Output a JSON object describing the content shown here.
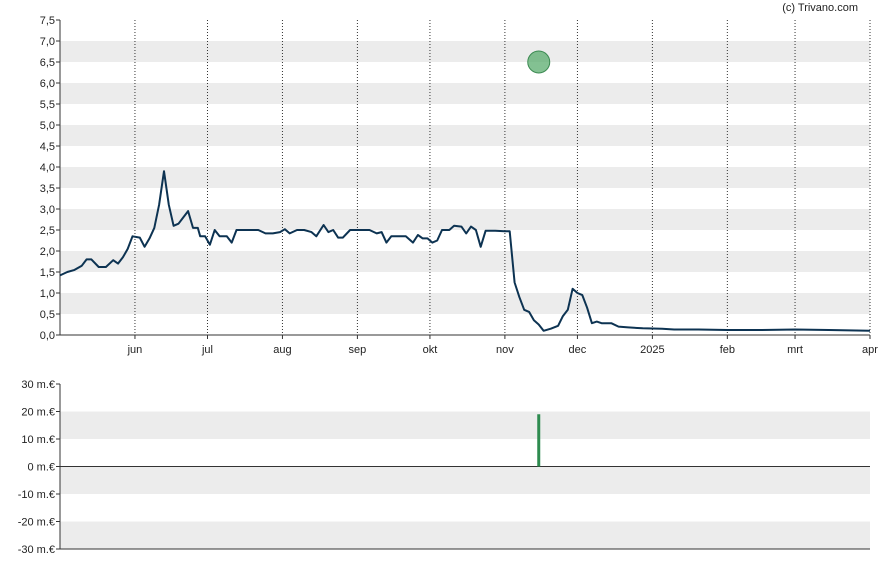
{
  "credit": "(c) Trivano.com",
  "chart_data": [
    {
      "type": "line",
      "title": "",
      "xlabel": "",
      "ylabel": "",
      "ylim": [
        0,
        7.5
      ],
      "grid": "alternating horizontal bands, dotted vertical month lines",
      "x_tick_labels": [
        "jun",
        "jul",
        "aug",
        "sep",
        "okt",
        "nov",
        "dec",
        "2025",
        "feb",
        "mrt",
        "apr"
      ],
      "x_tick_dates": [
        "2024-06-01",
        "2024-07-01",
        "2024-08-01",
        "2024-09-01",
        "2024-10-01",
        "2024-11-01",
        "2024-12-01",
        "2025-01-01",
        "2025-02-01",
        "2025-03-01",
        "2025-04-01"
      ],
      "x_range": [
        "2024-05-01",
        "2025-04-01"
      ],
      "y_tick_labels": [
        "0,0",
        "0,5",
        "1,0",
        "1,5",
        "2,0",
        "2,5",
        "3,0",
        "3,5",
        "4,0",
        "4,5",
        "5,0",
        "5,5",
        "6,0",
        "6,5",
        "7,0",
        "7,5"
      ],
      "line_color": "#0d3352",
      "series": [
        {
          "points": [
            [
              "2024-05-01",
              1.42
            ],
            [
              "2024-05-04",
              1.5
            ],
            [
              "2024-05-07",
              1.55
            ],
            [
              "2024-05-10",
              1.65
            ],
            [
              "2024-05-12",
              1.8
            ],
            [
              "2024-05-14",
              1.8
            ],
            [
              "2024-05-17",
              1.62
            ],
            [
              "2024-05-20",
              1.62
            ],
            [
              "2024-05-23",
              1.78
            ],
            [
              "2024-05-25",
              1.7
            ],
            [
              "2024-05-27",
              1.85
            ],
            [
              "2024-05-29",
              2.05
            ],
            [
              "2024-05-31",
              2.35
            ],
            [
              "2024-06-03",
              2.32
            ],
            [
              "2024-06-05",
              2.1
            ],
            [
              "2024-06-07",
              2.3
            ],
            [
              "2024-06-09",
              2.55
            ],
            [
              "2024-06-11",
              3.1
            ],
            [
              "2024-06-13",
              3.9
            ],
            [
              "2024-06-15",
              3.1
            ],
            [
              "2024-06-17",
              2.6
            ],
            [
              "2024-06-19",
              2.65
            ],
            [
              "2024-06-21",
              2.8
            ],
            [
              "2024-06-23",
              2.95
            ],
            [
              "2024-06-25",
              2.55
            ],
            [
              "2024-06-27",
              2.55
            ],
            [
              "2024-06-28",
              2.35
            ],
            [
              "2024-06-30",
              2.35
            ],
            [
              "2024-07-02",
              2.15
            ],
            [
              "2024-07-04",
              2.5
            ],
            [
              "2024-07-06",
              2.35
            ],
            [
              "2024-07-09",
              2.35
            ],
            [
              "2024-07-11",
              2.2
            ],
            [
              "2024-07-13",
              2.5
            ],
            [
              "2024-07-17",
              2.5
            ],
            [
              "2024-07-22",
              2.5
            ],
            [
              "2024-07-25",
              2.42
            ],
            [
              "2024-07-28",
              2.42
            ],
            [
              "2024-07-31",
              2.45
            ],
            [
              "2024-08-02",
              2.52
            ],
            [
              "2024-08-04",
              2.42
            ],
            [
              "2024-08-07",
              2.5
            ],
            [
              "2024-08-10",
              2.5
            ],
            [
              "2024-08-13",
              2.45
            ],
            [
              "2024-08-15",
              2.35
            ],
            [
              "2024-08-18",
              2.62
            ],
            [
              "2024-08-20",
              2.45
            ],
            [
              "2024-08-22",
              2.5
            ],
            [
              "2024-08-24",
              2.32
            ],
            [
              "2024-08-26",
              2.32
            ],
            [
              "2024-08-29",
              2.5
            ],
            [
              "2024-09-01",
              2.5
            ],
            [
              "2024-09-04",
              2.5
            ],
            [
              "2024-09-06",
              2.5
            ],
            [
              "2024-09-09",
              2.42
            ],
            [
              "2024-09-11",
              2.45
            ],
            [
              "2024-09-13",
              2.2
            ],
            [
              "2024-09-15",
              2.35
            ],
            [
              "2024-09-18",
              2.35
            ],
            [
              "2024-09-21",
              2.35
            ],
            [
              "2024-09-24",
              2.2
            ],
            [
              "2024-09-26",
              2.38
            ],
            [
              "2024-09-28",
              2.3
            ],
            [
              "2024-09-30",
              2.3
            ],
            [
              "2024-10-02",
              2.2
            ],
            [
              "2024-10-04",
              2.25
            ],
            [
              "2024-10-06",
              2.5
            ],
            [
              "2024-10-09",
              2.5
            ],
            [
              "2024-10-11",
              2.6
            ],
            [
              "2024-10-14",
              2.58
            ],
            [
              "2024-10-16",
              2.42
            ],
            [
              "2024-10-18",
              2.58
            ],
            [
              "2024-10-20",
              2.5
            ],
            [
              "2024-10-22",
              2.1
            ],
            [
              "2024-10-24",
              2.48
            ],
            [
              "2024-10-28",
              2.48
            ],
            [
              "2024-11-01",
              2.47
            ],
            [
              "2024-11-03",
              2.47
            ],
            [
              "2024-11-05",
              1.25
            ],
            [
              "2024-11-07",
              0.9
            ],
            [
              "2024-11-09",
              0.6
            ],
            [
              "2024-11-11",
              0.55
            ],
            [
              "2024-11-13",
              0.35
            ],
            [
              "2024-11-15",
              0.25
            ],
            [
              "2024-11-17",
              0.1
            ],
            [
              "2024-11-20",
              0.15
            ],
            [
              "2024-11-23",
              0.22
            ],
            [
              "2024-11-25",
              0.45
            ],
            [
              "2024-11-27",
              0.6
            ],
            [
              "2024-11-29",
              1.1
            ],
            [
              "2024-12-01",
              1.0
            ],
            [
              "2024-12-03",
              0.95
            ],
            [
              "2024-12-05",
              0.65
            ],
            [
              "2024-12-07",
              0.28
            ],
            [
              "2024-12-09",
              0.32
            ],
            [
              "2024-12-11",
              0.28
            ],
            [
              "2024-12-15",
              0.28
            ],
            [
              "2024-12-18",
              0.2
            ],
            [
              "2024-12-22",
              0.18
            ],
            [
              "2024-12-28",
              0.16
            ],
            [
              "2025-01-05",
              0.15
            ],
            [
              "2025-01-10",
              0.13
            ],
            [
              "2025-01-20",
              0.13
            ],
            [
              "2025-02-01",
              0.12
            ],
            [
              "2025-02-15",
              0.12
            ],
            [
              "2025-03-01",
              0.13
            ],
            [
              "2025-03-15",
              0.12
            ],
            [
              "2025-04-01",
              0.1
            ]
          ]
        }
      ],
      "markers": [
        {
          "date": "2024-11-15",
          "value": 6.5,
          "color": "#5aac6e"
        }
      ]
    },
    {
      "type": "bar",
      "title": "",
      "xlabel": "",
      "ylabel": "",
      "ylim": [
        -30,
        30
      ],
      "y_tick_labels": [
        "30 m.€",
        "20 m.€",
        "10 m.€",
        "0 m.€",
        "-10 m.€",
        "-20 m.€",
        "-30 m.€"
      ],
      "y_tick_values": [
        30,
        20,
        10,
        0,
        -10,
        -20,
        -30
      ],
      "bar_color": "#2e8b4f",
      "values": [
        {
          "date": "2024-11-15",
          "value": 19
        }
      ]
    }
  ]
}
